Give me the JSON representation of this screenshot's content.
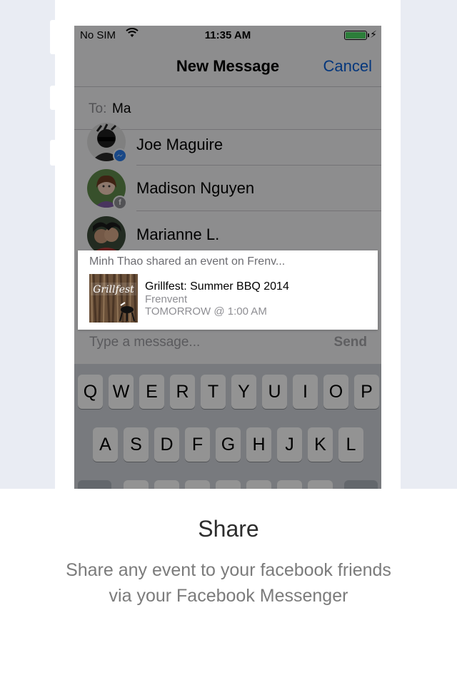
{
  "status_bar": {
    "carrier": "No SIM",
    "time": "11:35 AM"
  },
  "nav": {
    "title": "New Message",
    "cancel": "Cancel"
  },
  "to_field": {
    "label": "To:",
    "value": "Ma"
  },
  "contacts": [
    {
      "name": "Joe Maguire",
      "badge_icon": "messenger-badge-icon"
    },
    {
      "name": "Madison Nguyen",
      "badge_icon": "facebook-badge-icon"
    },
    {
      "name": "Marianne L."
    }
  ],
  "message": {
    "placeholder": "Type a message...",
    "send": "Send"
  },
  "keyboard": {
    "row1": [
      "Q",
      "W",
      "E",
      "R",
      "T",
      "Y",
      "U",
      "I",
      "O",
      "P"
    ],
    "row2": [
      "A",
      "S",
      "D",
      "F",
      "G",
      "H",
      "J",
      "K",
      "L"
    ]
  },
  "share_card": {
    "sharer": "Minh Thao shared an event on Frenv...",
    "thumbnail_text": "Grillfest",
    "event_title": "Grillfest: Summer BBQ 2014",
    "source": "Frenvent",
    "time": "TOMORROW @ 1:00 AM"
  },
  "caption": {
    "heading": "Share",
    "description_line1": "Share any event to your facebook friends",
    "description_line2": "via your Facebook Messenger"
  },
  "colors": {
    "background_top": "#e9ecf3",
    "accent_blue": "#0a5fd6",
    "battery_green": "#4cd964",
    "messenger_blue": "#2b7ce9",
    "facebook_gray": "#8e8e93",
    "heading_text": "#2d2d2d",
    "description_text": "#7b7b7b"
  }
}
